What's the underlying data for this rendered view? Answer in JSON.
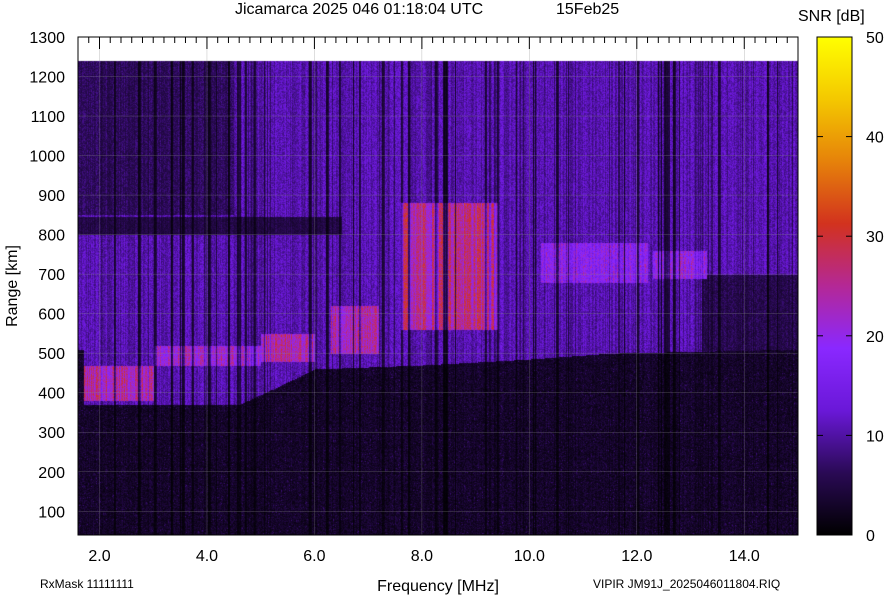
{
  "header": {
    "title": "Jicamarca 2025 046 01:18:04 UTC",
    "date": "15Feb25"
  },
  "footer": {
    "rxmask": "RxMask 11111111",
    "filename": "VIPIR  JM91J_2025046011804.RIQ"
  },
  "colorbar": {
    "title": "SNR [dB]",
    "ticks": [
      "0",
      "10",
      "20",
      "30",
      "40",
      "50"
    ],
    "colors": [
      "#000000",
      "#2a0a55",
      "#6a18d8",
      "#8a28ff",
      "#b42896",
      "#d2321e",
      "#e6820a",
      "#f4c800",
      "#ffff00"
    ]
  },
  "chart_data": {
    "type": "heatmap",
    "title": "Jicamarca 2025 046 01:18:04 UTC",
    "xlabel": "Frequency [MHz]",
    "ylabel": "Range [km]",
    "xlim": [
      1.6,
      15.0
    ],
    "ylim": [
      40,
      1300
    ],
    "xticks": [
      2.0,
      4.0,
      6.0,
      8.0,
      10.0,
      12.0,
      14.0
    ],
    "xtick_labels": [
      "2.0",
      "4.0",
      "6.0",
      "8.0",
      "10.0",
      "12.0",
      "14.0"
    ],
    "yticks": [
      100,
      200,
      300,
      400,
      500,
      600,
      700,
      800,
      900,
      1000,
      1100,
      1200,
      1300
    ],
    "ytick_labels": [
      "100",
      "200",
      "300",
      "400",
      "500",
      "600",
      "700",
      "800",
      "900",
      "1000",
      "1100",
      "1200",
      "1300"
    ],
    "colorbar_label": "SNR [dB]",
    "colorbar_range": [
      0,
      50
    ],
    "grid": true,
    "data_range_max_km": 1240,
    "echo_trace": [
      {
        "freq_mhz": 1.7,
        "range_km": 370
      },
      {
        "freq_mhz": 3.0,
        "range_km": 370
      },
      {
        "freq_mhz": 4.6,
        "range_km": 370
      },
      {
        "freq_mhz": 5.4,
        "range_km": 420
      },
      {
        "freq_mhz": 6.0,
        "range_km": 460
      },
      {
        "freq_mhz": 8.0,
        "range_km": 470
      },
      {
        "freq_mhz": 10.0,
        "range_km": 485
      },
      {
        "freq_mhz": 11.5,
        "range_km": 500
      },
      {
        "freq_mhz": 15.0,
        "range_km": 510
      }
    ],
    "strong_echo_regions": [
      {
        "freq_mhz": [
          1.7,
          3.0
        ],
        "range_km": [
          380,
          470
        ],
        "snr_db": 26
      },
      {
        "freq_mhz": [
          3.0,
          5.0
        ],
        "range_km": [
          470,
          520
        ],
        "snr_db": 23
      },
      {
        "freq_mhz": [
          5.0,
          6.0
        ],
        "range_km": [
          480,
          550
        ],
        "snr_db": 26
      },
      {
        "freq_mhz": [
          6.3,
          7.2
        ],
        "range_km": [
          500,
          620
        ],
        "snr_db": 25
      },
      {
        "freq_mhz": [
          7.6,
          9.4
        ],
        "range_km": [
          560,
          880
        ],
        "snr_db": 28
      },
      {
        "freq_mhz": [
          10.2,
          12.2
        ],
        "range_km": [
          680,
          780
        ],
        "snr_db": 20
      },
      {
        "freq_mhz": [
          12.3,
          13.3
        ],
        "range_km": [
          690,
          760
        ],
        "snr_db": 21
      }
    ]
  }
}
